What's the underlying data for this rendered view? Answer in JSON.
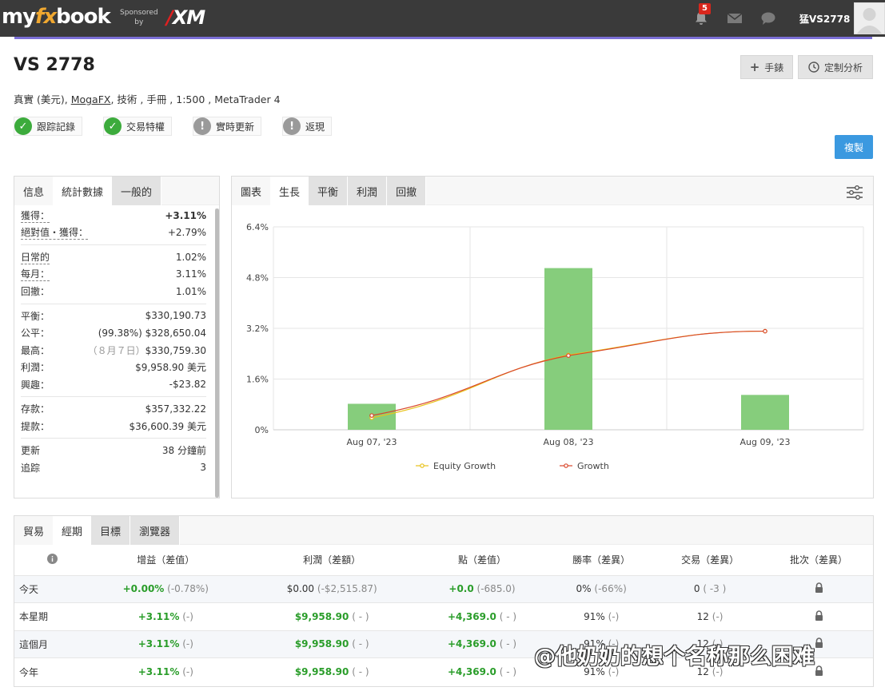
{
  "nav": {
    "logo_my": "my",
    "logo_fx": "fx",
    "logo_book": "book",
    "sponsored": "Sponsored",
    "by": "by",
    "sponsor_brand": "XM",
    "notification_count": "5",
    "username": "猛VS2778"
  },
  "account": {
    "title": "VS 2778",
    "type": "真實 (美元),",
    "broker": "MogaFX",
    "details": ", 技術 , 手冊 , 1:500 , MetaTrader 4"
  },
  "buttons": {
    "manual": "手錶",
    "custom_analysis": "定制分析",
    "copy": "複製"
  },
  "badges": [
    {
      "label": "跟踪記錄",
      "status": "ok"
    },
    {
      "label": "交易特權",
      "status": "ok"
    },
    {
      "label": "實時更新",
      "status": "warn"
    },
    {
      "label": "返現",
      "status": "warn"
    }
  ],
  "stats_panel": {
    "tabs": [
      "信息",
      "統計數據",
      "一般的"
    ],
    "gain_label": "獲得：",
    "gain": "+3.11%",
    "abs_gain_label": "絕對值・獲得：",
    "abs_gain": "+2.79%",
    "daily_label": "日常的",
    "daily": "1.02%",
    "monthly_label": "每月：",
    "monthly": "3.11%",
    "drawdown_label": "回撤：",
    "drawdown": "1.01%",
    "balance_label": "平衡：",
    "balance": "$330,190.73",
    "equity_label": "公平：",
    "equity": "(99.38%) $328,650.04",
    "highest_label": "最高：",
    "highest_date": "（８月７日）",
    "highest": "$330,759.30",
    "profit_label": "利潤：",
    "profit": "$9,958.90 美元",
    "interest_label": "興趣：",
    "interest": "-$23.82",
    "deposits_label": "存款：",
    "deposits": "$357,332.22",
    "withdrawals_label": "提款：",
    "withdrawals": "$36,600.39 美元",
    "updated_label": "更新",
    "updated": "38 分鐘前",
    "tracking_label": "追踪",
    "tracking": "3"
  },
  "chart_panel": {
    "tabs": [
      "圖表",
      "生長",
      "平衡",
      "利潤",
      "回撤"
    ],
    "active_tab": "生長"
  },
  "chart_data": {
    "type": "bar",
    "categories": [
      "Aug 07, '23",
      "Aug 08, '23",
      "Aug 09, '23"
    ],
    "bars": {
      "values": [
        0.82,
        5.1,
        1.1
      ],
      "color": "#86cd7c"
    },
    "series": [
      {
        "name": "Equity Growth",
        "type": "line",
        "values": [
          0.38,
          2.36,
          3.11
        ],
        "color": "#e8c21a"
      },
      {
        "name": "Growth",
        "type": "line",
        "values": [
          0.45,
          2.34,
          3.11
        ],
        "color": "#d9472b"
      }
    ],
    "y_ticks": [
      "0%",
      "1.6%",
      "3.2%",
      "4.8%",
      "6.4%"
    ],
    "ylim": [
      0,
      6.4
    ],
    "legend_position": "bottom",
    "grid": true
  },
  "periods_panel": {
    "tabs": [
      "貿易",
      "經期",
      "目標",
      "瀏覽器"
    ],
    "headers": [
      "",
      "增益（差值）",
      "利潤（差額）",
      "點（差值）",
      "勝率（差異）",
      "交易（差異）",
      "批次（差異）"
    ],
    "rows": [
      {
        "period": "今天",
        "gain": "+0.00%",
        "gain_diff": "(-0.78%)",
        "profit": "$0.00",
        "profit_diff": "(-$2,515.87)",
        "pips": "+0.0",
        "pips_diff": "(-685.0)",
        "winrate": "0%",
        "winrate_diff": "(-66%)",
        "trades": "0",
        "trades_diff": "( -3 )"
      },
      {
        "period": "本星期",
        "gain": "+3.11%",
        "gain_diff": "(-)",
        "profit": "$9,958.90",
        "profit_diff": "( - )",
        "pips": "+4,369.0",
        "pips_diff": "( - )",
        "winrate": "91%",
        "winrate_diff": "(-)",
        "trades": "12",
        "trades_diff": "(-)"
      },
      {
        "period": "這個月",
        "gain": "+3.11%",
        "gain_diff": "(-)",
        "profit": "$9,958.90",
        "profit_diff": "( - )",
        "pips": "+4,369.0",
        "pips_diff": "( - )",
        "winrate": "91%",
        "winrate_diff": "(-)",
        "trades": "12",
        "trades_diff": "(-)"
      },
      {
        "period": "今年",
        "gain": "+3.11%",
        "gain_diff": "(-)",
        "profit": "$9,958.90",
        "profit_diff": "( - )",
        "pips": "+4,369.0",
        "pips_diff": "( - )",
        "winrate": "91%",
        "winrate_diff": "(-)",
        "trades": "12",
        "trades_diff": "(-)"
      }
    ]
  },
  "watermark": "@他奶奶的想个名称那么困难"
}
